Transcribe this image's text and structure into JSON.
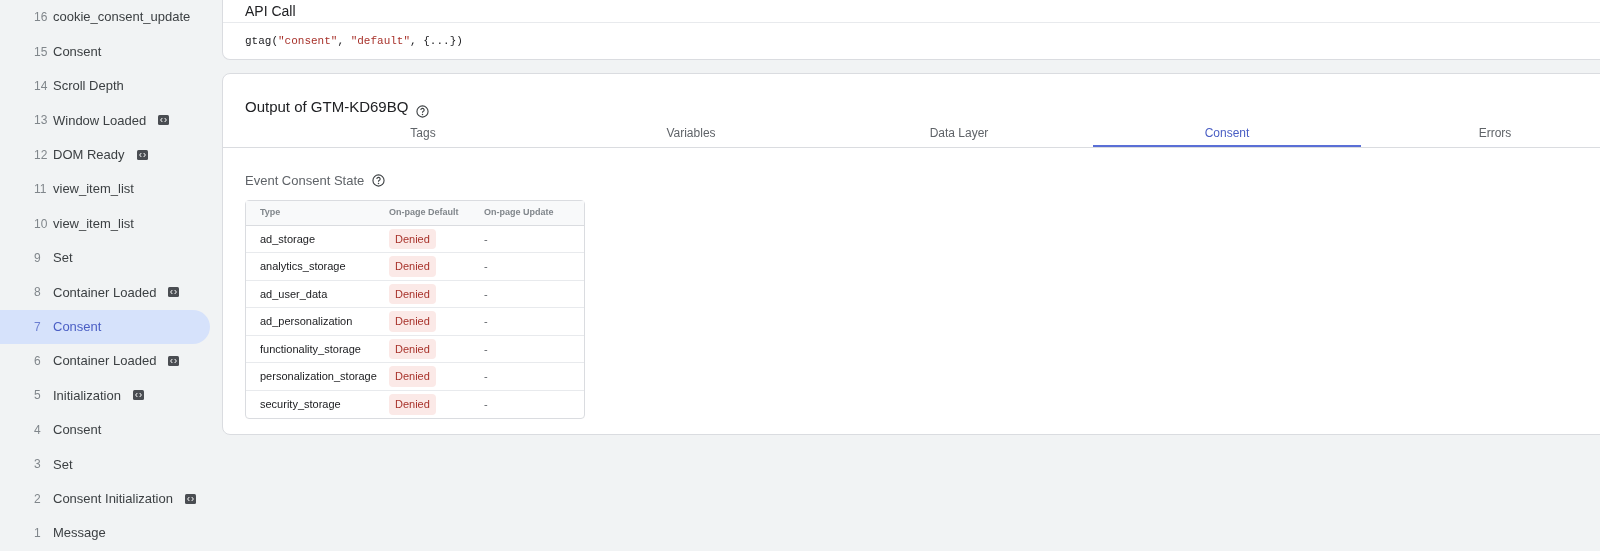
{
  "sidebar": {
    "items": [
      {
        "number": "16",
        "label": "cookie_consent_update",
        "code_badge": false,
        "selected": false
      },
      {
        "number": "15",
        "label": "Consent",
        "code_badge": false,
        "selected": false
      },
      {
        "number": "14",
        "label": "Scroll Depth",
        "code_badge": false,
        "selected": false
      },
      {
        "number": "13",
        "label": "Window Loaded",
        "code_badge": true,
        "selected": false
      },
      {
        "number": "12",
        "label": "DOM Ready",
        "code_badge": true,
        "selected": false
      },
      {
        "number": "11",
        "label": "view_item_list",
        "code_badge": false,
        "selected": false
      },
      {
        "number": "10",
        "label": "view_item_list",
        "code_badge": false,
        "selected": false
      },
      {
        "number": "9",
        "label": "Set",
        "code_badge": false,
        "selected": false
      },
      {
        "number": "8",
        "label": "Container Loaded",
        "code_badge": true,
        "selected": false
      },
      {
        "number": "7",
        "label": "Consent",
        "code_badge": false,
        "selected": true
      },
      {
        "number": "6",
        "label": "Container Loaded",
        "code_badge": true,
        "selected": false
      },
      {
        "number": "5",
        "label": "Initialization",
        "code_badge": true,
        "selected": false
      },
      {
        "number": "4",
        "label": "Consent",
        "code_badge": false,
        "selected": false
      },
      {
        "number": "3",
        "label": "Set",
        "code_badge": false,
        "selected": false
      },
      {
        "number": "2",
        "label": "Consent Initialization",
        "code_badge": true,
        "selected": false
      },
      {
        "number": "1",
        "label": "Message",
        "code_badge": false,
        "selected": false
      }
    ]
  },
  "api_call": {
    "title": "API Call",
    "code": [
      {
        "text": "gtag(",
        "kind": "plain"
      },
      {
        "text": "\"consent\"",
        "kind": "string"
      },
      {
        "text": ", ",
        "kind": "plain"
      },
      {
        "text": "\"default\"",
        "kind": "string"
      },
      {
        "text": ", {...})",
        "kind": "plain"
      }
    ]
  },
  "output": {
    "title": "Output of GTM-KD69BQ",
    "tabs": [
      {
        "label": "Tags",
        "selected": false
      },
      {
        "label": "Variables",
        "selected": false
      },
      {
        "label": "Data Layer",
        "selected": false
      },
      {
        "label": "Consent",
        "selected": true
      },
      {
        "label": "Errors",
        "selected": false
      }
    ],
    "section_title": "Event Consent State",
    "table": {
      "columns": [
        "Type",
        "On-page Default",
        "On-page Update"
      ],
      "rows": [
        {
          "type": "ad_storage",
          "default": "Denied",
          "update": "-"
        },
        {
          "type": "analytics_storage",
          "default": "Denied",
          "update": "-"
        },
        {
          "type": "ad_user_data",
          "default": "Denied",
          "update": "-"
        },
        {
          "type": "ad_personalization",
          "default": "Denied",
          "update": "-"
        },
        {
          "type": "functionality_storage",
          "default": "Denied",
          "update": "-"
        },
        {
          "type": "personalization_storage",
          "default": "Denied",
          "update": "-"
        },
        {
          "type": "security_storage",
          "default": "Denied",
          "update": "-"
        }
      ]
    }
  }
}
